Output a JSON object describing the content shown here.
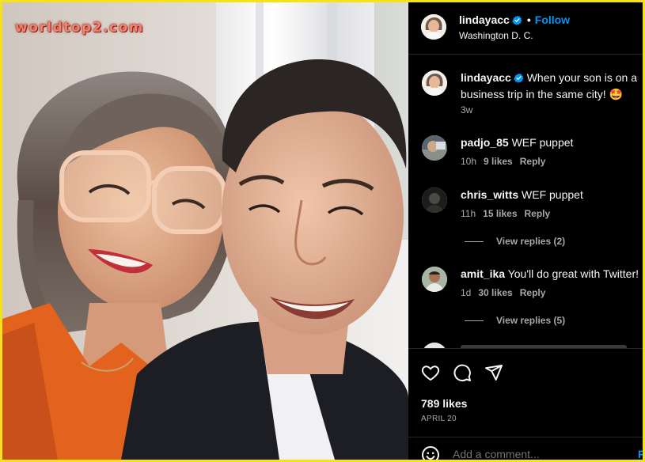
{
  "watermark": "worldtop2.com",
  "post": {
    "username": "lindayacc",
    "follow_label": "Follow",
    "dot": "•",
    "location": "Washington D. C.",
    "caption_text": "When your son is on a business trip in the same city! 🤩",
    "caption_time": "3w"
  },
  "comments": [
    {
      "username": "padjo_85",
      "text": "WEF puppet",
      "time": "10h",
      "likes": "9 likes",
      "reply": "Reply"
    },
    {
      "username": "chris_witts",
      "text": "WEF puppet",
      "time": "11h",
      "likes": "15 likes",
      "reply": "Reply",
      "view_replies": "View replies (2)"
    },
    {
      "username": "amit_ika",
      "text": "You'll do great with Twitter!",
      "time": "1d",
      "likes": "30 likes",
      "reply": "Reply",
      "view_replies": "View replies (5)"
    }
  ],
  "actions": {
    "likes_count": "789 likes",
    "date": "APRIL 20",
    "add_comment_placeholder": "Add a comment...",
    "post_label": "P"
  },
  "colors": {
    "frame": "#f6e21a",
    "panel_bg": "#000000",
    "link_blue": "#0095f6",
    "verified_blue": "#0095f6",
    "secondary_text": "#a8a8a8"
  },
  "icons": [
    "verified-badge-icon",
    "heart-icon",
    "comment-icon",
    "share-icon",
    "emoji-icon"
  ]
}
